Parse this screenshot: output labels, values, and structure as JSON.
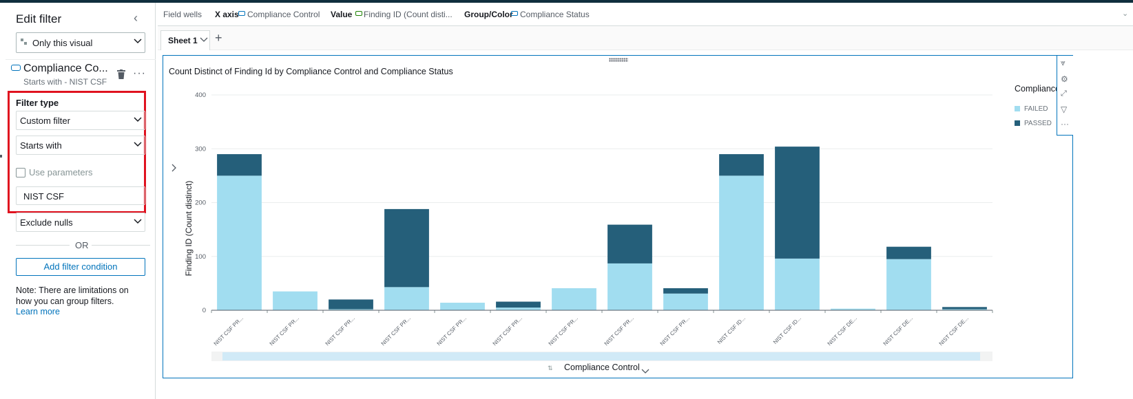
{
  "left_panel": {
    "title": "Edit filter",
    "scope_select": "Only this visual",
    "field_name": "Compliance Co...",
    "field_condition": "Starts with - NIST CSF",
    "filter_type_label": "Filter type",
    "filter_type_value": "Custom filter",
    "operator_value": "Starts with",
    "use_parameters_label": "Use parameters",
    "filter_value": "NIST CSF",
    "nulls_value": "Exclude nulls",
    "or_label": "OR",
    "add_condition_label": "Add filter condition",
    "note": "Note: There are limitations on how you can group filters.",
    "learn_more": "Learn more"
  },
  "field_wells": {
    "label": "Field wells",
    "x_axis_label": "X axis",
    "x_axis_field": "Compliance Control",
    "value_label": "Value",
    "value_field": "Finding ID (Count disti...",
    "group_label": "Group/Color",
    "group_field": "Compliance Status"
  },
  "sheet": {
    "tab_label": "Sheet 1"
  },
  "visual": {
    "title": "Count Distinct of Finding Id by Compliance Control and Compliance Status",
    "legend_title": "Compliance",
    "x_label": "Compliance Control",
    "y_label": "Finding ID (Count distinct)"
  },
  "colors": {
    "failed": "#a1ddf0",
    "passed": "#255f7a",
    "accent": "#0073bb",
    "highlight": "#e0121f"
  },
  "chart_data": {
    "type": "bar",
    "stacked": true,
    "categories": [
      "NIST CSF PR...",
      "NIST CSF PR...",
      "NIST CSF PR...",
      "NIST CSF PR...",
      "NIST CSF PR...",
      "NIST CSF PR...",
      "NIST CSF PR...",
      "NIST CSF PR...",
      "NIST CSF PR...",
      "NIST CSF ID...",
      "NIST CSF ID...",
      "NIST CSF DE...",
      "NIST CSF DE...",
      "NIST CSF DE..."
    ],
    "series": [
      {
        "name": "FAILED",
        "values": [
          250,
          35,
          2,
          43,
          14,
          5,
          41,
          87,
          31,
          250,
          96,
          3,
          95,
          2
        ]
      },
      {
        "name": "PASSED",
        "values": [
          40,
          0,
          18,
          145,
          0,
          11,
          0,
          72,
          10,
          40,
          208,
          0,
          23,
          4
        ]
      }
    ],
    "yticks": [
      0,
      100,
      200,
      300,
      400
    ],
    "ylim": [
      0,
      400
    ],
    "xlabel": "Compliance Control",
    "ylabel": "Finding ID (Count distinct)",
    "legend_position": "right",
    "grid": true
  }
}
